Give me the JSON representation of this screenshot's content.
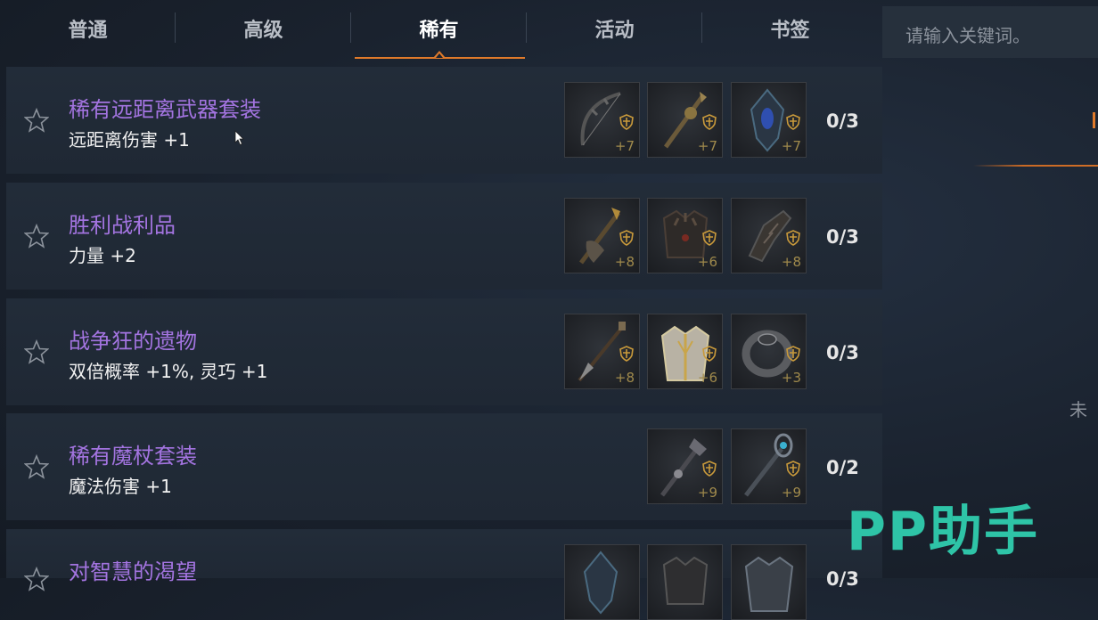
{
  "tabs": [
    {
      "label": "普通",
      "active": false
    },
    {
      "label": "高级",
      "active": false
    },
    {
      "label": "稀有",
      "active": true
    },
    {
      "label": "活动",
      "active": false
    },
    {
      "label": "书签",
      "active": false
    }
  ],
  "search": {
    "placeholder": "请输入关键词。"
  },
  "side_panel": {
    "partial_text": "未"
  },
  "colors": {
    "accent": "#e07a2a",
    "set_name": "#a374e0",
    "panel": "#222c39",
    "watermark": "#2ec4a7"
  },
  "sets": [
    {
      "name": "稀有远距离武器套装",
      "bonus": "远距离伤害 +1",
      "progress": "0/3",
      "items": [
        {
          "icon": "bow-icon",
          "level": "+7"
        },
        {
          "icon": "staff-icon",
          "level": "+7"
        },
        {
          "icon": "gem-amulet-icon",
          "level": "+7"
        }
      ]
    },
    {
      "name": "胜利战利品",
      "bonus": "力量 +2",
      "progress": "0/3",
      "items": [
        {
          "icon": "axe-icon",
          "level": "+8"
        },
        {
          "icon": "armor-icon",
          "level": "+6"
        },
        {
          "icon": "gauntlet-icon",
          "level": "+8"
        }
      ]
    },
    {
      "name": "战争狂的遗物",
      "bonus": "双倍概率 +1%, 灵巧 +1",
      "progress": "0/3",
      "items": [
        {
          "icon": "spear-icon",
          "level": "+8"
        },
        {
          "icon": "robe-icon",
          "level": "+6"
        },
        {
          "icon": "ring-icon",
          "level": "+3"
        }
      ]
    },
    {
      "name": "稀有魔杖套装",
      "bonus": "魔法伤害 +1",
      "progress": "0/2",
      "items": [
        {
          "icon": "wand-icon",
          "level": "+9"
        },
        {
          "icon": "crystal-staff-icon",
          "level": "+9"
        }
      ]
    },
    {
      "name": "对智慧的渴望",
      "bonus": "",
      "progress": "0/3",
      "items": [
        {
          "icon": "gem-amulet-icon",
          "level": ""
        },
        {
          "icon": "armor-icon",
          "level": ""
        },
        {
          "icon": "robe-icon",
          "level": ""
        }
      ]
    }
  ],
  "watermark": "PP助手"
}
